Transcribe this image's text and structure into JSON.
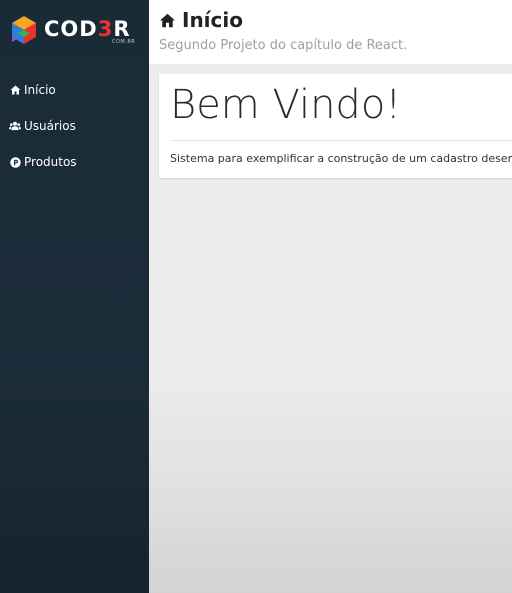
{
  "sidebar": {
    "logo": {
      "text_white": "COD",
      "text_red": "3",
      "text_white_end": "R",
      "tagline": "COM.BR"
    },
    "items": [
      {
        "label": "Início",
        "icon": "home-icon"
      },
      {
        "label": "Usuários",
        "icon": "users-icon"
      },
      {
        "label": "Produtos",
        "icon": "product-circle-icon"
      }
    ]
  },
  "header": {
    "title": "Início",
    "subtitle": "Segundo Projeto do capítulo de React."
  },
  "main": {
    "card": {
      "heading": "Bem Vindo!",
      "text": "Sistema para exemplificar a construção de um cadastro desenvolvido em React."
    }
  },
  "colors": {
    "sidebar_bg": "#1a2b38",
    "logo_red": "#e8322d",
    "content_bg": "#ececec"
  }
}
